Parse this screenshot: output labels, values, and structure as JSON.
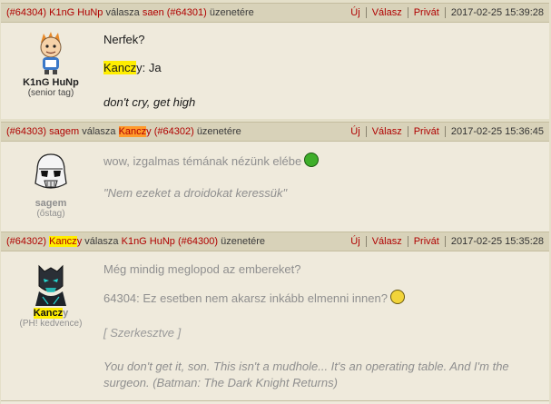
{
  "posts": [
    {
      "num": "(#64304)",
      "author": "K1nG HuNp",
      "reply_word": "válasza",
      "target_user": "saen",
      "target_num": "(#64301)",
      "suffix": "üzenetére",
      "links": [
        "Új",
        "Válasz",
        "Privát"
      ],
      "date": "2017-02-25 15:39:28",
      "user_name": "K1nG HuNp",
      "user_rank": "(senior tag)",
      "lines": [
        "Nerfek?"
      ],
      "quote_user_hl": "Kancz",
      "quote_user_rest": "y",
      "quote_text": ": Ja",
      "sig": "don't cry, get high"
    },
    {
      "num": "(#64303)",
      "author": "sagem",
      "reply_word": "válasza",
      "target_user_hl": "Kancz",
      "target_user_rest": "y",
      "target_num": "(#64302)",
      "suffix": "üzenetére",
      "links": [
        "Új",
        "Válasz",
        "Privát"
      ],
      "date": "2017-02-25 15:36:45",
      "user_name": "sagem",
      "user_rank": "(őstag)",
      "line": "wow, izgalmas témának nézünk elébe",
      "sig": "\"Nem ezeket a droidokat keressük\""
    },
    {
      "num": "(#64302)",
      "author_hl": "Kancz",
      "author_rest": "y",
      "reply_word": "válasza",
      "target_user": "K1nG HuNp",
      "target_num": "(#64300)",
      "suffix": "üzenetére",
      "links": [
        "Új",
        "Válasz",
        "Privát"
      ],
      "date": "2017-02-25 15:35:28",
      "user_name_hl": "Kancz",
      "user_name_rest": "y",
      "user_rank": "(PH! kedvence)",
      "line1": "Még mindig meglopod az embereket?",
      "line2": "64304: Ez esetben nem akarsz inkább elmenni innen?",
      "edited": "[ Szerkesztve ]",
      "sig": "You don't get it, son. This isn't a mudhole... It's an operating table. And I'm the surgeon. (Batman: The Dark Knight Returns)"
    }
  ],
  "colors": {
    "link_red": "#b00000",
    "highlight_yellow": "#ffee00",
    "highlight_orange": "#ff9a2b",
    "header_bg": "#d8d2b9",
    "body_bg": "#efeadc"
  }
}
